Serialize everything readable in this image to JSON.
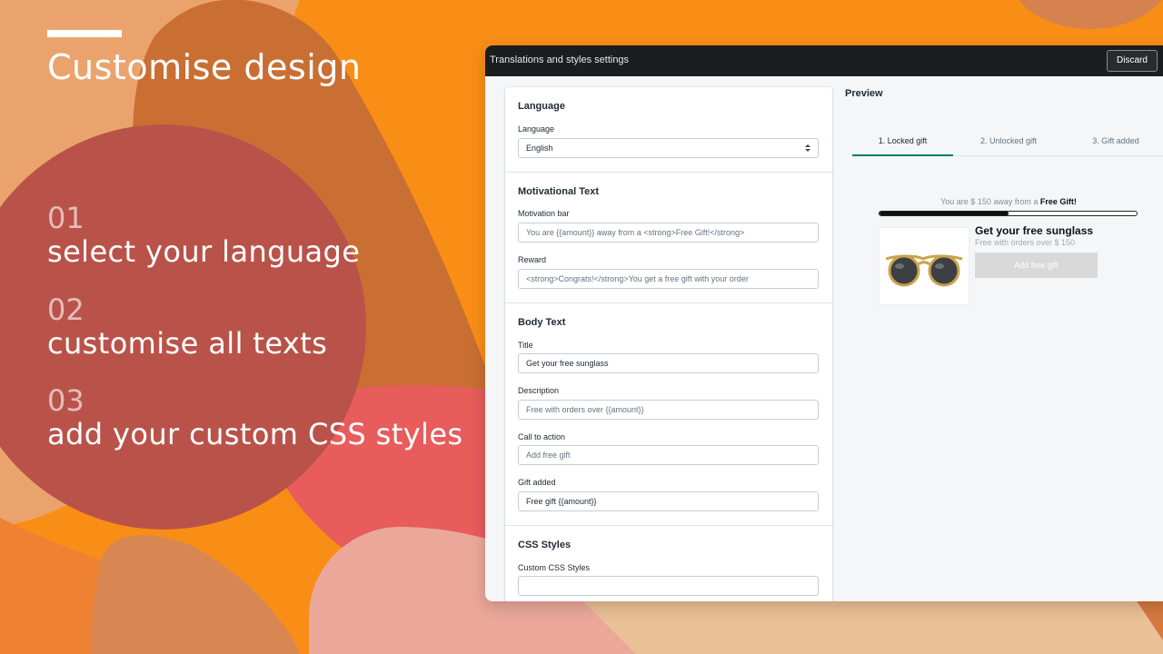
{
  "hero": {
    "title": "Customise design",
    "steps": [
      {
        "num": "01",
        "text": "select your language"
      },
      {
        "num": "02",
        "text": "customise all texts"
      },
      {
        "num": "03",
        "text": "add your custom CSS styles"
      }
    ]
  },
  "window": {
    "title": "Translations and styles settings",
    "discard_label": "Discard"
  },
  "form": {
    "language": {
      "section_title": "Language",
      "label": "Language",
      "value": "English"
    },
    "motivational": {
      "section_title": "Motivational Text",
      "bar_label": "Motivation bar",
      "bar_placeholder": "You are {{amount}} away from a <strong>Free Gift!</strong>",
      "reward_label": "Reward",
      "reward_placeholder": "<strong>Congrats!</strong>You get a free gift with your order"
    },
    "body": {
      "section_title": "Body Text",
      "title_label": "Title",
      "title_value": "Get your free sunglass",
      "description_label": "Description",
      "description_placeholder": "Free with orders over {{amount}}",
      "cta_label": "Call to action",
      "cta_placeholder": "Add free gift",
      "gift_added_label": "Gift added",
      "gift_added_value": "Free gift {{amount}}"
    },
    "css": {
      "section_title": "CSS Styles",
      "label": "Custom CSS Styles",
      "value": ""
    }
  },
  "preview": {
    "title": "Preview",
    "tabs": [
      "1. Locked gift",
      "2. Unlocked gift",
      "3. Gift added"
    ],
    "active_tab": 0,
    "motivation_prefix": "You are $ 150 away from a ",
    "motivation_bold": "Free Gift!",
    "progress": 0.5,
    "product_title": "Get your free sunglass",
    "product_desc": "Free with orders over $ 150",
    "button_label": "Add free gift"
  },
  "colors": {
    "background": "#F7931E",
    "accent_green": "#008060",
    "topbar": "#1C1D1F"
  }
}
